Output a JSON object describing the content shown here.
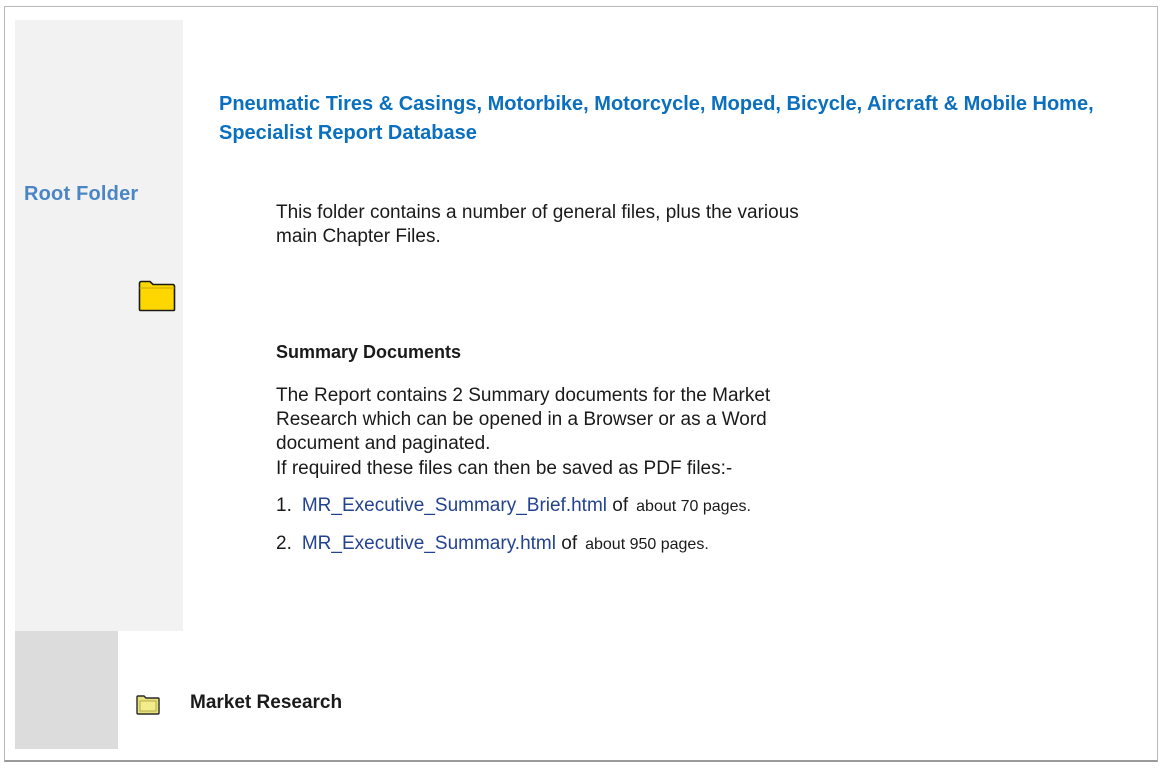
{
  "sidebar": {
    "root_label": "Root Folder"
  },
  "header": {
    "title": "Pneumatic Tires & Casings, Motorbike, Motorcycle, Moped, Bicycle, Aircraft & Mobile Home, Specialist Report Database"
  },
  "main": {
    "intro": "This folder contains a number of general files, plus the various main Chapter Files.",
    "summary_heading": "Summary Documents",
    "summary_text": "The Report contains 2 Summary documents for the Market Research which can be opened in a Browser or as a Word document and paginated.",
    "pdf_text": "If required these files can then be saved as PDF files:-",
    "files": [
      {
        "num": "1.",
        "name": "MR_Executive_Summary_Brief.html",
        "pre": "of",
        "tail": "about 70 pages."
      },
      {
        "num": "2.",
        "name": "MR_Executive_Summary.html",
        "pre": "of",
        "tail": "about 950 pages."
      }
    ]
  },
  "footer": {
    "folder_label": "Market Research"
  },
  "colors": {
    "title": "#0a6fbf",
    "root_label": "#4a86c5",
    "link": "#23428f",
    "folder_fill": "#ffd700",
    "folder_stroke": "#1a1a1a"
  },
  "icons": {
    "root_folder": "folder-icon",
    "market_folder": "folder-icon"
  }
}
